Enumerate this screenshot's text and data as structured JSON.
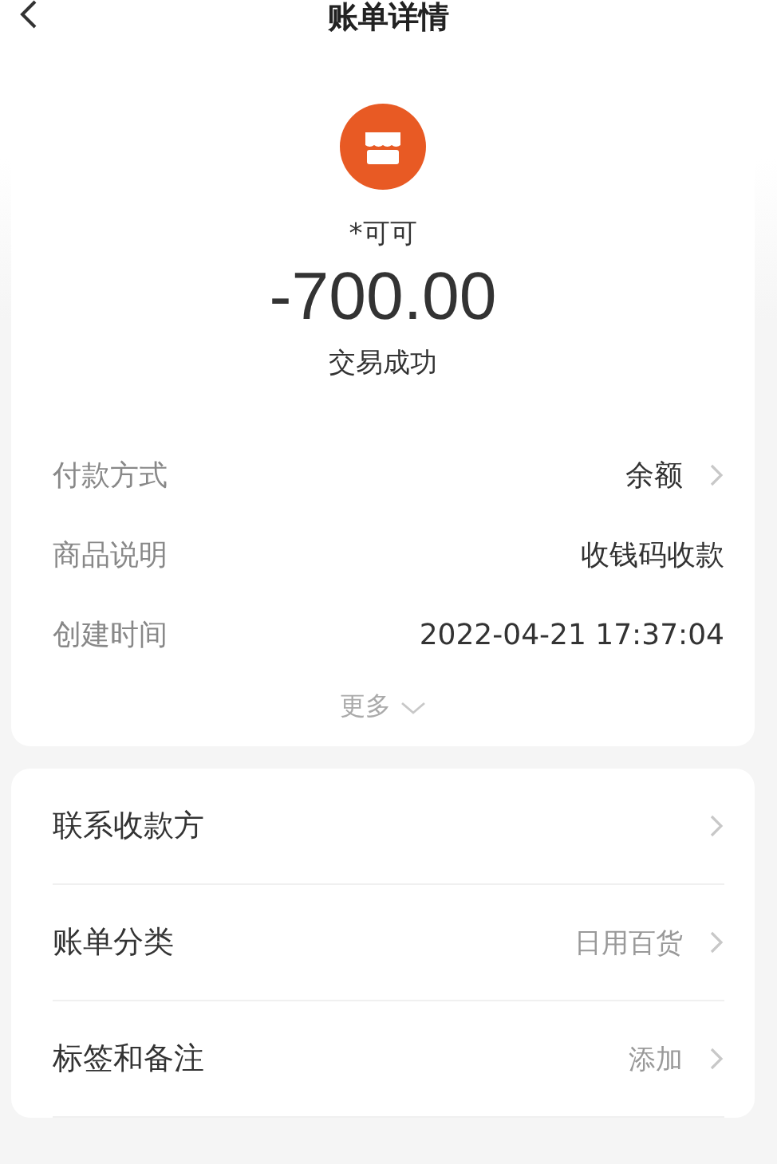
{
  "header": {
    "title": "账单详情"
  },
  "summary": {
    "payee": "*可可",
    "amount": "-700.00",
    "status": "交易成功"
  },
  "details": [
    {
      "label": "付款方式",
      "value": "余额",
      "arrow": true
    },
    {
      "label": "商品说明",
      "value": "收钱码收款",
      "arrow": false
    },
    {
      "label": "创建时间",
      "value": "2022-04-21 17:37:04",
      "arrow": false
    }
  ],
  "more": {
    "label": "更多",
    "expanded": false
  },
  "actions": [
    {
      "label": "联系收款方"
    },
    {
      "label": "账单分类",
      "value": "日用百货"
    },
    {
      "label": "标签和备注",
      "value": "添加"
    }
  ]
}
